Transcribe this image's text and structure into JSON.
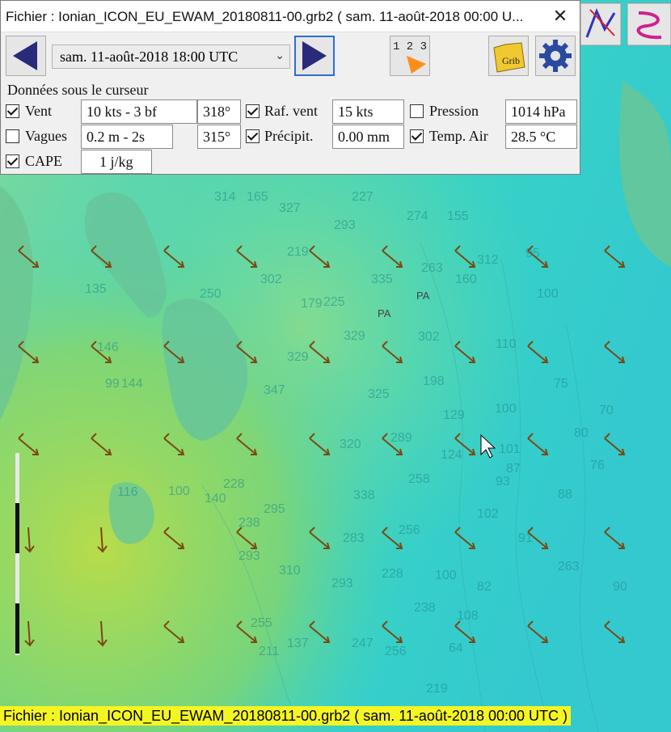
{
  "window": {
    "title": "Fichier : Ionian_ICON_EU_EWAM_20180811-00.grb2 ( sam. 11-août-2018 00:00  U...",
    "close_glyph": "✕"
  },
  "toolbar": {
    "date_value": "sam. 11-août-2018 18:00  UTC",
    "counter_label": "1 2 3",
    "grib_label": "Grib"
  },
  "panel": {
    "header": "Données sous le curseur",
    "vent": {
      "label": "Vent",
      "checked": true,
      "value": "10 kts -  3 bf",
      "dir": "318°"
    },
    "raf": {
      "label": "Raf. vent",
      "checked": true,
      "value": "15 kts"
    },
    "pression": {
      "label": "Pression",
      "checked": false,
      "value": "1014 hPa"
    },
    "vagues": {
      "label": "Vagues",
      "checked": false,
      "value": "0.2 m - 2s",
      "dir": "315°"
    },
    "precip": {
      "label": "Précipit.",
      "checked": true,
      "value": "0.00 mm"
    },
    "temp": {
      "label": "Temp. Air",
      "checked": true,
      "value": "28.5 °C"
    },
    "cape": {
      "label": "CAPE",
      "checked": true,
      "value": "1 j/kg"
    }
  },
  "status": {
    "text": "Fichier : Ionian_ICON_EU_EWAM_20180811-00.grb2 ( sam. 11-août-2018 00:00  UTC )"
  },
  "map": {
    "depths": [
      "314",
      "165",
      "327",
      "227",
      "274",
      "155",
      "293",
      "219",
      "335",
      "263",
      "312",
      "160",
      "95",
      "302",
      "179",
      "225",
      "250",
      "329",
      "302",
      "110",
      "135",
      "146",
      "347",
      "325",
      "198",
      "329",
      "129",
      "100",
      "100",
      "75",
      "70",
      "99",
      "144",
      "320",
      "289",
      "124",
      "101",
      "87",
      "80",
      "76",
      "116",
      "100",
      "338",
      "258",
      "93",
      "88",
      "140",
      "228",
      "295",
      "256",
      "102",
      "91",
      "283",
      "238",
      "310",
      "293",
      "228",
      "100",
      "82",
      "263",
      "293",
      "90",
      "255",
      "247",
      "238",
      "108",
      "211",
      "137",
      "256",
      "64",
      "219"
    ],
    "marks": [
      "PA",
      "PA"
    ],
    "colors": {
      "sea": "#3fd0c0",
      "land": "#6cc08a",
      "arrow": "#7a4a14",
      "status_bg": "#f5f522"
    }
  }
}
